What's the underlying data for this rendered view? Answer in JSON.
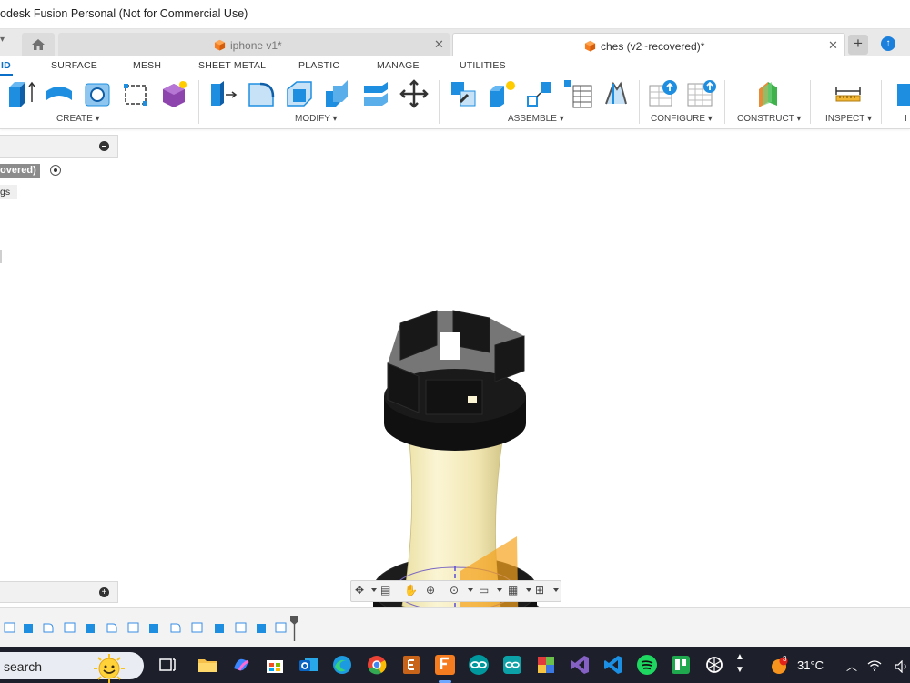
{
  "window": {
    "title": "odesk Fusion Personal (Not for Commercial Use)"
  },
  "tabs": [
    {
      "label": "iphone v1*",
      "active": false
    },
    {
      "label": "ches (v2~recovered)*",
      "active": true
    }
  ],
  "ribbon_tabs": [
    "ID",
    "SURFACE",
    "MESH",
    "SHEET METAL",
    "PLASTIC",
    "MANAGE",
    "UTILITIES"
  ],
  "toolbar_groups": {
    "create": "CREATE",
    "modify": "MODIFY",
    "assemble": "ASSEMBLE",
    "configure": "CONFIGURE",
    "construct": "CONSTRUCT",
    "inspect": "INSPECT",
    "insert": "I"
  },
  "browser": {
    "root_label": "overed)",
    "item_label": "gs"
  },
  "taskbar": {
    "search_text": "search",
    "temperature": "31°C",
    "weather_badge": "3"
  },
  "colors": {
    "accent_blue": "#0a6fc8",
    "fusion_orange": "#f57c1f",
    "selection_orange": "#f7a21b",
    "rook_body": "#f4eab9",
    "rook_black": "#111111",
    "taskbar_bg": "#1d1f2b"
  }
}
